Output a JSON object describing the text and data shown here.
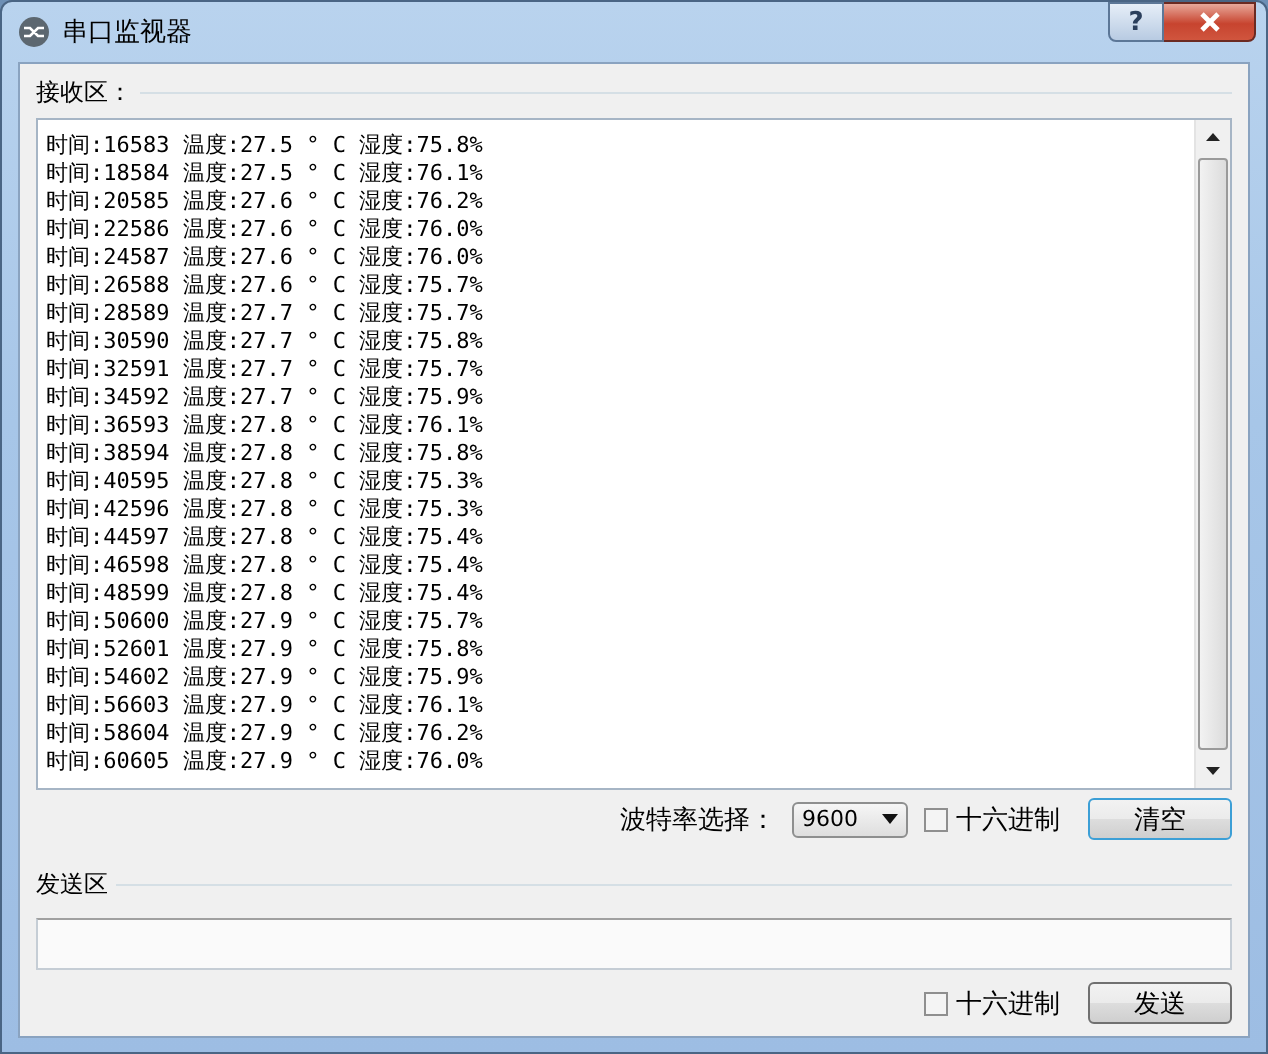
{
  "window": {
    "title": "串口监视器",
    "help_button": "?"
  },
  "receive": {
    "label": "接收区：",
    "lines": [
      "时间:16583 温度:27.5 ° C 湿度:75.8%",
      "时间:18584 温度:27.5 ° C 湿度:76.1%",
      "时间:20585 温度:27.6 ° C 湿度:76.2%",
      "时间:22586 温度:27.6 ° C 湿度:76.0%",
      "时间:24587 温度:27.6 ° C 湿度:76.0%",
      "时间:26588 温度:27.6 ° C 湿度:75.7%",
      "时间:28589 温度:27.7 ° C 湿度:75.7%",
      "时间:30590 温度:27.7 ° C 湿度:75.8%",
      "时间:32591 温度:27.7 ° C 湿度:75.7%",
      "时间:34592 温度:27.7 ° C 湿度:75.9%",
      "时间:36593 温度:27.8 ° C 湿度:76.1%",
      "时间:38594 温度:27.8 ° C 湿度:75.8%",
      "时间:40595 温度:27.8 ° C 湿度:75.3%",
      "时间:42596 温度:27.8 ° C 湿度:75.3%",
      "时间:44597 温度:27.8 ° C 湿度:75.4%",
      "时间:46598 温度:27.8 ° C 湿度:75.4%",
      "时间:48599 温度:27.8 ° C 湿度:75.4%",
      "时间:50600 温度:27.9 ° C 湿度:75.7%",
      "时间:52601 温度:27.9 ° C 湿度:75.8%",
      "时间:54602 温度:27.9 ° C 湿度:75.9%",
      "时间:56603 温度:27.9 ° C 湿度:76.1%",
      "时间:58604 温度:27.9 ° C 湿度:76.2%",
      "时间:60605 温度:27.9 ° C 湿度:76.0%"
    ],
    "baud_label": "波特率选择：",
    "baud_value": "9600",
    "hex": {
      "label": "十六进制",
      "checked": false
    },
    "clear_button": "清空"
  },
  "send": {
    "label": "发送区",
    "hex": {
      "label": "十六进制",
      "checked": false
    },
    "send_button": "发送"
  }
}
